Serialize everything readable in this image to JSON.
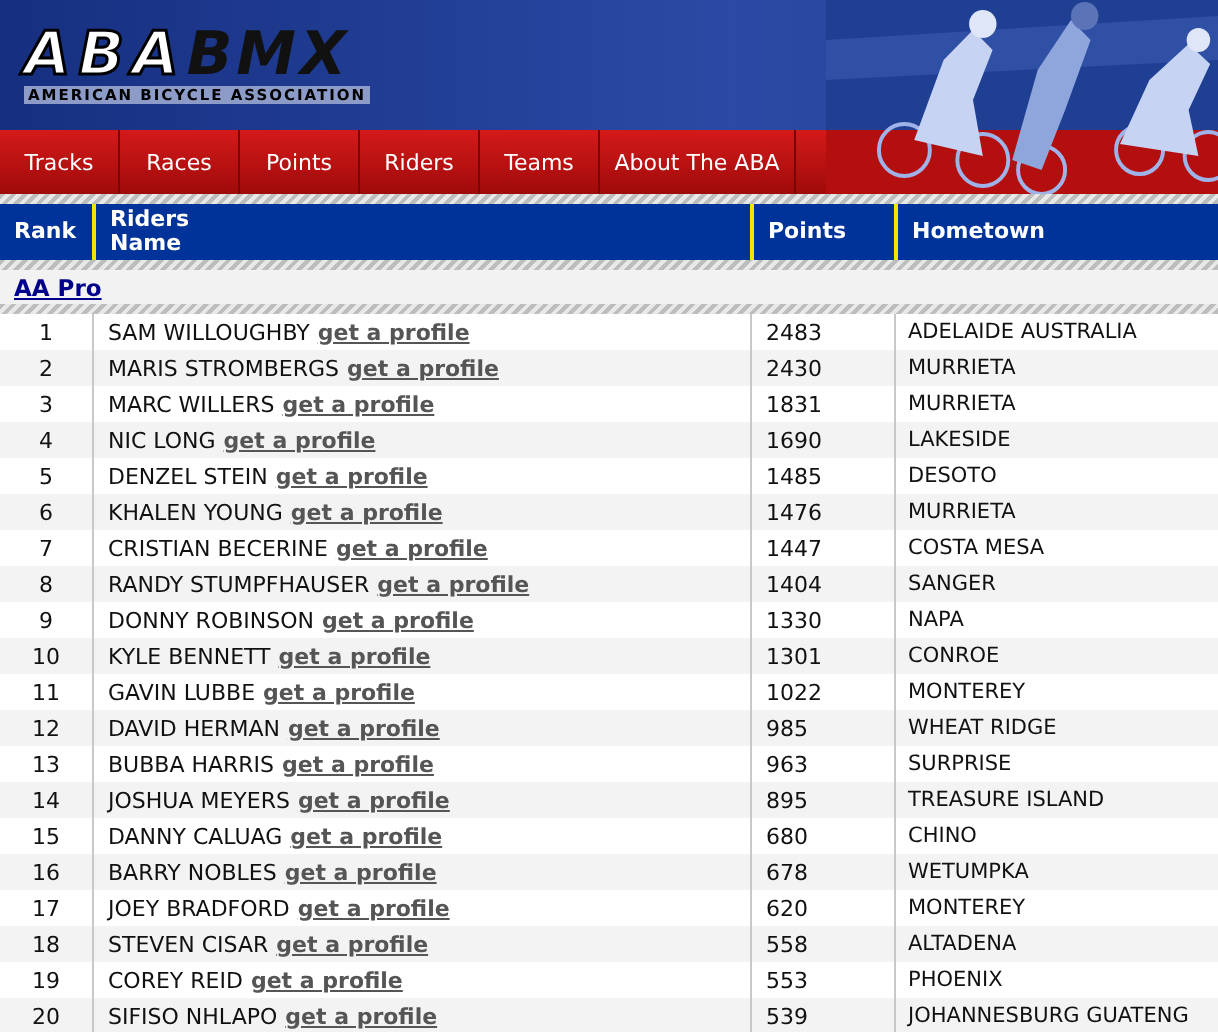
{
  "logo": {
    "mark": "ABA",
    "brand": "BMX",
    "tagline": "AMERICAN BICYCLE ASSOCIATION"
  },
  "nav": [
    "Tracks",
    "Races",
    "Points",
    "Riders",
    "Teams",
    "About The ABA"
  ],
  "table": {
    "columns": [
      "Rank",
      "Riders\nName",
      "Points",
      "Hometown"
    ],
    "group": "AA Pro",
    "rows": [
      {
        "rank": "1",
        "name": "SAM WILLOUGHBY",
        "link": "get a profile",
        "points": "2483",
        "hometown": "ADELAIDE AUSTRALIA"
      },
      {
        "rank": "2",
        "name": "MARIS STROMBERGS",
        "link": "get a profile",
        "points": "2430",
        "hometown": "MURRIETA"
      },
      {
        "rank": "3",
        "name": "MARC WILLERS",
        "link": "get a profile",
        "points": "1831",
        "hometown": "MURRIETA"
      },
      {
        "rank": "4",
        "name": "NIC LONG",
        "link": "get a profile",
        "points": "1690",
        "hometown": "LAKESIDE"
      },
      {
        "rank": "5",
        "name": "DENZEL STEIN",
        "link": "get a profile",
        "points": "1485",
        "hometown": "DESOTO"
      },
      {
        "rank": "6",
        "name": "KHALEN YOUNG",
        "link": "get a profile",
        "points": "1476",
        "hometown": "MURRIETA"
      },
      {
        "rank": "7",
        "name": "CRISTIAN BECERINE",
        "link": "get a profile",
        "points": "1447",
        "hometown": "COSTA MESA"
      },
      {
        "rank": "8",
        "name": "RANDY STUMPFHAUSER",
        "link": "get a profile",
        "points": "1404",
        "hometown": "SANGER"
      },
      {
        "rank": "9",
        "name": "DONNY ROBINSON",
        "link": "get a profile",
        "points": "1330",
        "hometown": "NAPA"
      },
      {
        "rank": "10",
        "name": "KYLE BENNETT",
        "link": "get a profile",
        "points": "1301",
        "hometown": "CONROE"
      },
      {
        "rank": "11",
        "name": "GAVIN LUBBE",
        "link": "get a profile",
        "points": "1022",
        "hometown": "MONTEREY"
      },
      {
        "rank": "12",
        "name": "DAVID HERMAN",
        "link": "get a profile",
        "points": "985",
        "hometown": "WHEAT RIDGE"
      },
      {
        "rank": "13",
        "name": "BUBBA HARRIS",
        "link": "get a profile",
        "points": "963",
        "hometown": "SURPRISE"
      },
      {
        "rank": "14",
        "name": "JOSHUA MEYERS",
        "link": "get a profile",
        "points": "895",
        "hometown": "TREASURE ISLAND"
      },
      {
        "rank": "15",
        "name": "DANNY CALUAG",
        "link": "get a profile",
        "points": "680",
        "hometown": "CHINO"
      },
      {
        "rank": "16",
        "name": "BARRY NOBLES",
        "link": "get a profile",
        "points": "678",
        "hometown": "WETUMPKA"
      },
      {
        "rank": "17",
        "name": "JOEY BRADFORD",
        "link": "get a profile",
        "points": "620",
        "hometown": "MONTEREY"
      },
      {
        "rank": "18",
        "name": "STEVEN CISAR",
        "link": "get a profile",
        "points": "558",
        "hometown": "ALTADENA"
      },
      {
        "rank": "19",
        "name": "COREY REID",
        "link": "get a profile",
        "points": "553",
        "hometown": "PHOENIX"
      },
      {
        "rank": "20",
        "name": "SIFISO NHLAPO",
        "link": "get a profile",
        "points": "539",
        "hometown": "JOHANNESBURG GUATENG"
      }
    ]
  }
}
